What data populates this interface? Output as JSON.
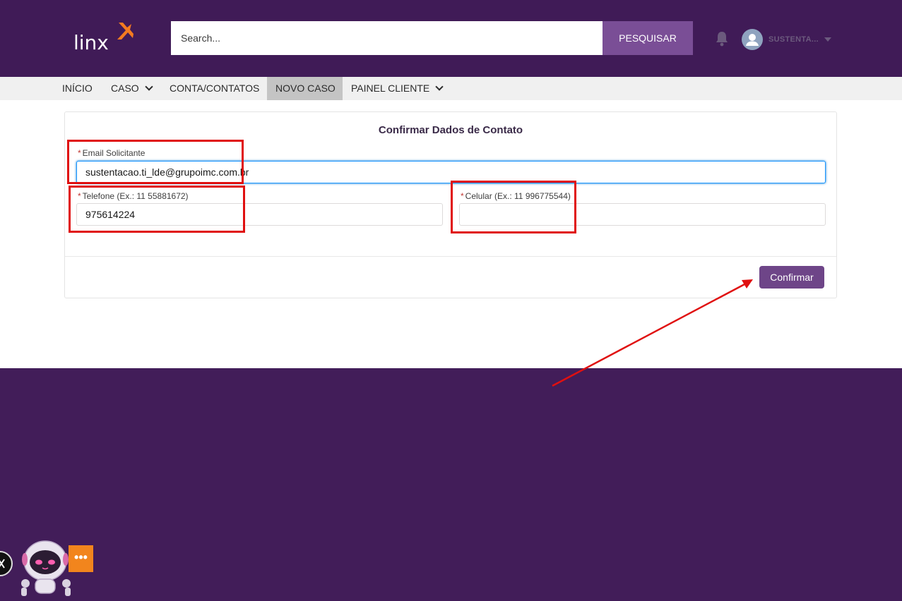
{
  "header": {
    "logo_text": "linx",
    "search": {
      "placeholder": "Search...",
      "button_label": "PESQUISAR"
    },
    "user_name": "SUSTENTA..."
  },
  "nav": {
    "items": [
      {
        "label": "INÍCIO",
        "has_dropdown": false
      },
      {
        "label": "CASO",
        "has_dropdown": true
      },
      {
        "label": "CONTA/CONTATOS",
        "has_dropdown": false
      },
      {
        "label": "NOVO CASO",
        "has_dropdown": false,
        "active": true
      },
      {
        "label": "PAINEL CLIENTE",
        "has_dropdown": true
      }
    ]
  },
  "form": {
    "title": "Confirmar Dados de Contato",
    "required_marker": "*",
    "email": {
      "label": "Email Solicitante",
      "value": "sustentacao.ti_lde@grupoimc.com.br"
    },
    "telefone": {
      "label": "Telefone (Ex.: 11 55881672)",
      "value": "975614224"
    },
    "celular": {
      "label": "Celular (Ex.: 11 996775544)",
      "value": ""
    },
    "confirm_label": "Confirmar"
  },
  "chat": {
    "bubble_text": "•••"
  },
  "colors": {
    "header_bg": "#401b57",
    "footer_bg": "#421d59",
    "button_bg": "#6e4588",
    "search_button_bg": "#7a4e96",
    "annotation": "#e01010",
    "logo_accent": "#f47b20"
  },
  "icons": [
    "linx-logo-icon",
    "bell-icon",
    "user-avatar-icon",
    "chevron-down-icon",
    "close-icon",
    "robot-assistant-icon"
  ]
}
